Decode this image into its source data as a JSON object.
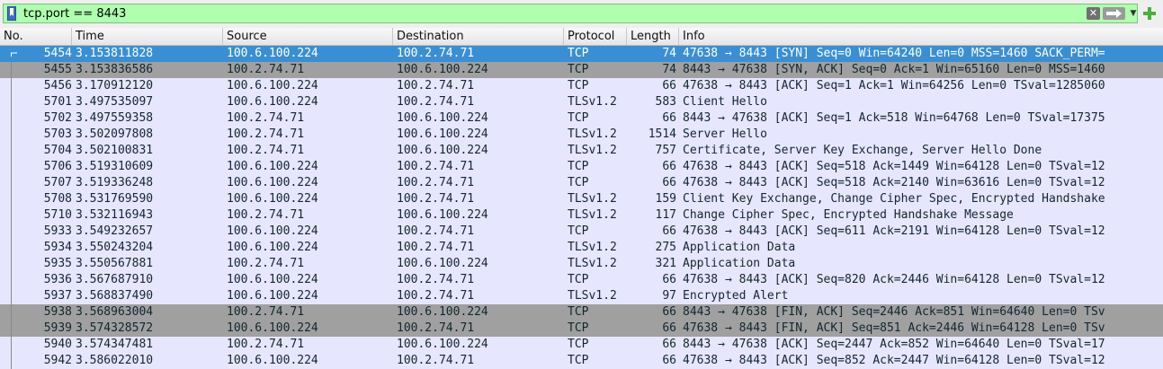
{
  "filter": {
    "value": "tcp.port == 8443",
    "clear_icon": "clear-icon",
    "apply_icon": "apply-arrow-icon",
    "dropdown_icon": "chevron-down-icon",
    "add_icon": "plus-icon",
    "bookmark_icon": "bookmark-icon",
    "color_valid": "#afffaf"
  },
  "columns": {
    "no": "No.",
    "time": "Time",
    "source": "Source",
    "destination": "Destination",
    "protocol": "Protocol",
    "length": "Length",
    "info": "Info"
  },
  "colors": {
    "row_normal": "#e7e6ff",
    "row_selected": "#3a8fd4",
    "row_gray": "#a0a0a0"
  },
  "packets": [
    {
      "no": "5454",
      "time": "3.153811828",
      "src": "100.6.100.224",
      "dst": "100.2.74.71",
      "proto": "TCP",
      "len": "74",
      "info": "47638 → 8443 [SYN] Seq=0 Win=64240 Len=0 MSS=1460 SACK_PERM=",
      "style": "selected"
    },
    {
      "no": "5455",
      "time": "3.153836586",
      "src": "100.2.74.71",
      "dst": "100.6.100.224",
      "proto": "TCP",
      "len": "74",
      "info": "8443 → 47638 [SYN, ACK] Seq=0 Ack=1 Win=65160 Len=0 MSS=1460",
      "style": "gray"
    },
    {
      "no": "5456",
      "time": "3.170912120",
      "src": "100.6.100.224",
      "dst": "100.2.74.71",
      "proto": "TCP",
      "len": "66",
      "info": "47638 → 8443 [ACK] Seq=1 Ack=1 Win=64256 Len=0 TSval=1285060",
      "style": "normal"
    },
    {
      "no": "5701",
      "time": "3.497535097",
      "src": "100.6.100.224",
      "dst": "100.2.74.71",
      "proto": "TLSv1.2",
      "len": "583",
      "info": "Client Hello",
      "style": "normal"
    },
    {
      "no": "5702",
      "time": "3.497559358",
      "src": "100.2.74.71",
      "dst": "100.6.100.224",
      "proto": "TCP",
      "len": "66",
      "info": "8443 → 47638 [ACK] Seq=1 Ack=518 Win=64768 Len=0 TSval=17375",
      "style": "normal"
    },
    {
      "no": "5703",
      "time": "3.502097808",
      "src": "100.2.74.71",
      "dst": "100.6.100.224",
      "proto": "TLSv1.2",
      "len": "1514",
      "info": "Server Hello",
      "style": "normal"
    },
    {
      "no": "5704",
      "time": "3.502100831",
      "src": "100.2.74.71",
      "dst": "100.6.100.224",
      "proto": "TLSv1.2",
      "len": "757",
      "info": "Certificate, Server Key Exchange, Server Hello Done",
      "style": "normal"
    },
    {
      "no": "5706",
      "time": "3.519310609",
      "src": "100.6.100.224",
      "dst": "100.2.74.71",
      "proto": "TCP",
      "len": "66",
      "info": "47638 → 8443 [ACK] Seq=518 Ack=1449 Win=64128 Len=0 TSval=12",
      "style": "normal"
    },
    {
      "no": "5707",
      "time": "3.519336248",
      "src": "100.6.100.224",
      "dst": "100.2.74.71",
      "proto": "TCP",
      "len": "66",
      "info": "47638 → 8443 [ACK] Seq=518 Ack=2140 Win=63616 Len=0 TSval=12",
      "style": "normal"
    },
    {
      "no": "5708",
      "time": "3.531769590",
      "src": "100.6.100.224",
      "dst": "100.2.74.71",
      "proto": "TLSv1.2",
      "len": "159",
      "info": "Client Key Exchange, Change Cipher Spec, Encrypted Handshake",
      "style": "normal"
    },
    {
      "no": "5710",
      "time": "3.532116943",
      "src": "100.2.74.71",
      "dst": "100.6.100.224",
      "proto": "TLSv1.2",
      "len": "117",
      "info": "Change Cipher Spec, Encrypted Handshake Message",
      "style": "normal"
    },
    {
      "no": "5933",
      "time": "3.549232657",
      "src": "100.6.100.224",
      "dst": "100.2.74.71",
      "proto": "TCP",
      "len": "66",
      "info": "47638 → 8443 [ACK] Seq=611 Ack=2191 Win=64128 Len=0 TSval=12",
      "style": "normal"
    },
    {
      "no": "5934",
      "time": "3.550243204",
      "src": "100.6.100.224",
      "dst": "100.2.74.71",
      "proto": "TLSv1.2",
      "len": "275",
      "info": "Application Data",
      "style": "normal"
    },
    {
      "no": "5935",
      "time": "3.550567881",
      "src": "100.2.74.71",
      "dst": "100.6.100.224",
      "proto": "TLSv1.2",
      "len": "321",
      "info": "Application Data",
      "style": "normal"
    },
    {
      "no": "5936",
      "time": "3.567687910",
      "src": "100.6.100.224",
      "dst": "100.2.74.71",
      "proto": "TCP",
      "len": "66",
      "info": "47638 → 8443 [ACK] Seq=820 Ack=2446 Win=64128 Len=0 TSval=12",
      "style": "normal"
    },
    {
      "no": "5937",
      "time": "3.568837490",
      "src": "100.6.100.224",
      "dst": "100.2.74.71",
      "proto": "TLSv1.2",
      "len": "97",
      "info": "Encrypted Alert",
      "style": "normal"
    },
    {
      "no": "5938",
      "time": "3.568963004",
      "src": "100.2.74.71",
      "dst": "100.6.100.224",
      "proto": "TCP",
      "len": "66",
      "info": "8443 → 47638 [FIN, ACK] Seq=2446 Ack=851 Win=64640 Len=0 TSv",
      "style": "gray"
    },
    {
      "no": "5939",
      "time": "3.574328572",
      "src": "100.6.100.224",
      "dst": "100.2.74.71",
      "proto": "TCP",
      "len": "66",
      "info": "47638 → 8443 [FIN, ACK] Seq=851 Ack=2446 Win=64128 Len=0 TSv",
      "style": "gray"
    },
    {
      "no": "5940",
      "time": "3.574347481",
      "src": "100.2.74.71",
      "dst": "100.6.100.224",
      "proto": "TCP",
      "len": "66",
      "info": "8443 → 47638 [ACK] Seq=2447 Ack=852 Win=64640 Len=0 TSval=17",
      "style": "normal"
    },
    {
      "no": "5942",
      "time": "3.586022010",
      "src": "100.6.100.224",
      "dst": "100.2.74.71",
      "proto": "TCP",
      "len": "66",
      "info": "47638 → 8443 [ACK] Seq=852 Ack=2447 Win=64128 Len=0 TSval=12",
      "style": "normal"
    }
  ]
}
